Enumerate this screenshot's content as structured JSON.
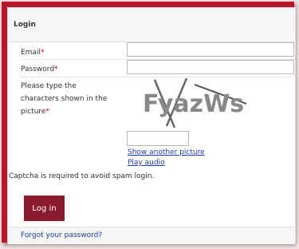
{
  "form": {
    "title": "Login",
    "email_label": "Email",
    "password_label": "Password",
    "captcha_label": "Please type the characters shown in the picture",
    "required_mark": "*",
    "captcha_text": "FyazWs",
    "show_another": "Show another picture",
    "play_audio": "Play audio",
    "note": "Captcha is required to avoid spam login.",
    "login_button": "Log in",
    "forgot_link": "Forgot your password?"
  },
  "colors": {
    "frame": "#c8102e",
    "button": "#8a1a2c",
    "link": "#1a3ea8",
    "required": "#d0021b"
  }
}
